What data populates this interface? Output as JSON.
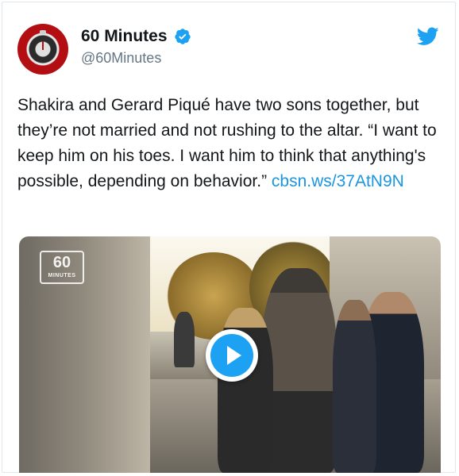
{
  "account": {
    "display_name": "60 Minutes",
    "handle": "@60Minutes",
    "verified": true,
    "avatar_icon": "stopwatch-icon",
    "platform_icon": "twitter-bird-icon"
  },
  "tweet": {
    "text": "Shakira and Gerard Piqué have two sons together, but they’re not married and not rushing to the altar. “I want to keep him on his toes. I want him to think that anything's possible, depending on behavior.” ",
    "link": "cbsn.ws/37AtN9N"
  },
  "media": {
    "type": "video",
    "watermark": "60",
    "watermark_sub": "MINUTES",
    "play_icon": "play-icon"
  },
  "colors": {
    "link": "#1b95e0",
    "verified": "#1da1f2",
    "brand_red": "#b30f12",
    "handle": "#657786"
  }
}
